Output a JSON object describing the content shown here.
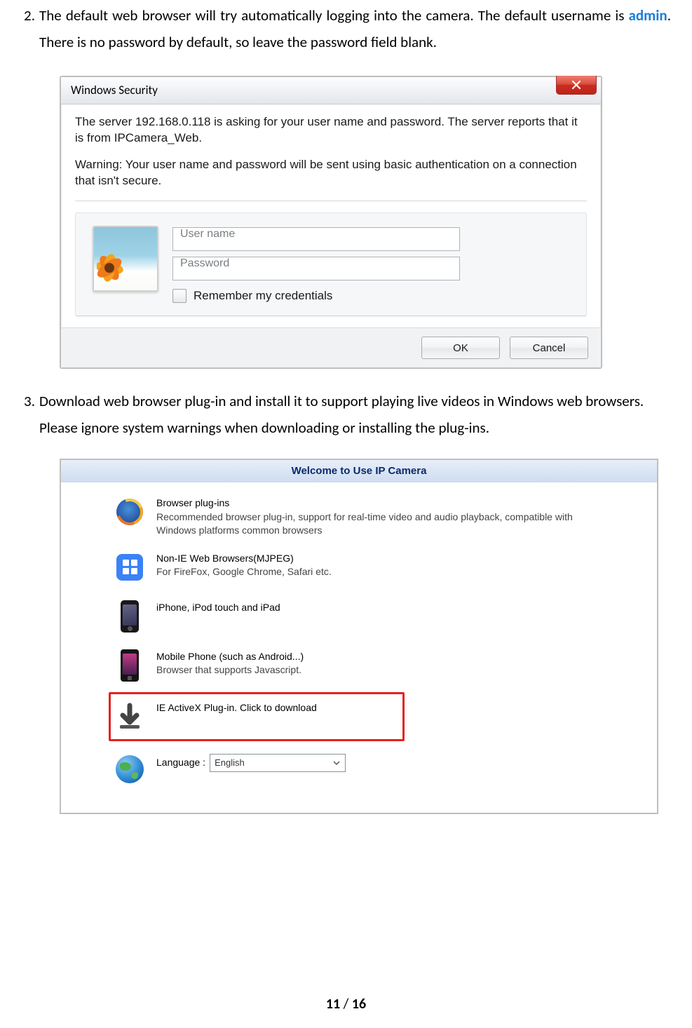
{
  "step2": {
    "num": "2.",
    "text_pre": "The  default  web  browser  will  try  automatically  logging  into  the  camera.  The default  username  is  ",
    "username": "admin",
    "text_post": ".  There  is  no  password  by  default,  so  leave  the password field blank."
  },
  "dialog": {
    "title": "Windows Security",
    "line1": "The server 192.168.0.118 is asking for your user name and password. The server reports that it is from IPCamera_Web.",
    "line2": "Warning: Your user name and password will be sent using basic authentication on a connection that isn't secure.",
    "user_ph": "User name",
    "pass_ph": "Password",
    "remember": "Remember my credentials",
    "ok": "OK",
    "cancel": "Cancel"
  },
  "step3": {
    "num": "3.",
    "text": "Download web browser plug-in and install it to support playing live videos in Windows web browsers. Please ignore system warnings when downloading or installing the plug-ins."
  },
  "welcome": {
    "title": "Welcome to Use IP Camera",
    "opt1_t": "Browser plug-ins",
    "opt1_d": "Recommended browser plug-in, support for real-time video and audio playback, compatible with Windows platforms common browsers",
    "opt2_t": "Non-IE Web Browsers(MJPEG)",
    "opt2_d": "For FireFox, Google Chrome, Safari etc.",
    "opt3_t": "iPhone, iPod touch and iPad",
    "opt4_t": "Mobile Phone (such as Android...)",
    "opt4_d": "Browser that supports Javascript.",
    "opt5_t": "IE ActiveX Plug-in. Click to download",
    "opt6_lbl": "Language :",
    "opt6_val": "English"
  },
  "footer": {
    "page": "11",
    "sep": " / ",
    "total": "16"
  }
}
